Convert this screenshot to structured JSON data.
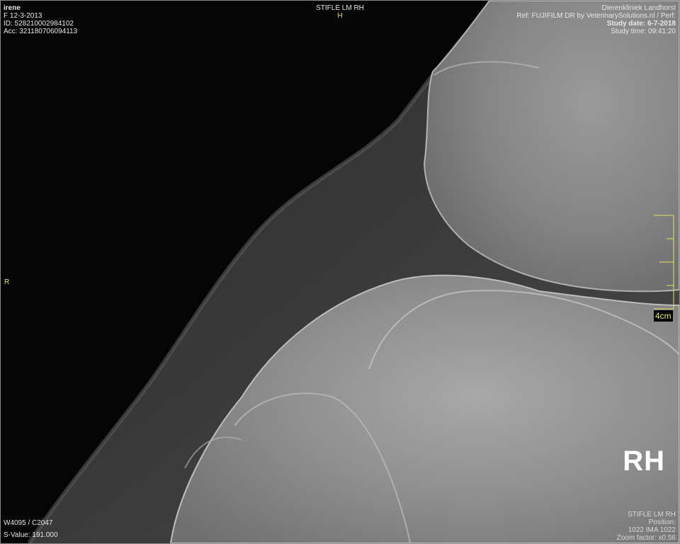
{
  "patient": {
    "name": "irene",
    "sex_dob": "F  12-3-2013",
    "id": "ID: 528210002984102",
    "acc": "Acc: 321180706094113"
  },
  "study": {
    "view": "STIFLE LM RH",
    "orientation_top": "H",
    "orientation_left": "R",
    "clinic": "Dierenkliniek Landhorst",
    "ref": "Ref: FUJIFILM DR by VeterinarySolutions.nl  /  Perf:",
    "date": "Study date: 6-7-2018",
    "time": "Study time: 09:41:20"
  },
  "display": {
    "window": "W4095 / C2047",
    "s_value": "S-Value: 191.000",
    "scale_label": "4cm",
    "marker": "RH",
    "series_label": "STIFLE LM RH",
    "position": "Position:",
    "image_index": "1022 IMA 1022",
    "zoom": "Zoom factor: x0.56"
  },
  "colors": {
    "overlay_text": "#e6e6e6",
    "marker_yellow": "#e8e25a",
    "border": "#8a8a8a"
  }
}
